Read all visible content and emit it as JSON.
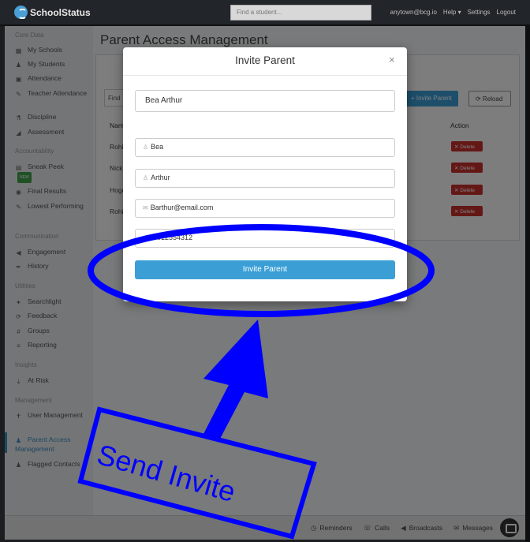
{
  "topbar": {
    "brand": "SchoolStatus",
    "search_placeholder": "Find a student...",
    "links": [
      "anytown@bcg.io",
      "Help ▾",
      "Settings",
      "Logout"
    ]
  },
  "sidebar": {
    "core_data": {
      "heading": "Core Data",
      "items": [
        {
          "label": "My Schools",
          "icon": "building-icon"
        },
        {
          "label": "My Students",
          "icon": "users-icon"
        },
        {
          "label": "Attendance",
          "icon": "calendar-icon"
        },
        {
          "label": "Teacher Attendance",
          "icon": "pencil-icon"
        },
        {
          "label": "Discipline",
          "icon": "flask-icon"
        },
        {
          "label": "Assessment",
          "icon": "chart-icon"
        }
      ]
    },
    "accountability": {
      "heading": "Accountability",
      "items": [
        {
          "label": "Sneak Peek",
          "icon": "document-icon",
          "badge": "NEW"
        },
        {
          "label": "Final Results",
          "icon": "eye-icon"
        },
        {
          "label": "Lowest Performing",
          "icon": "pencil-icon"
        }
      ]
    },
    "communication": {
      "heading": "Communication",
      "items": [
        {
          "label": "Engagement",
          "icon": "megaphone-icon"
        },
        {
          "label": "History",
          "icon": "pen-icon"
        }
      ]
    },
    "utilities": {
      "heading": "Utilities",
      "items": [
        {
          "label": "Searchlight",
          "icon": "flashlight-icon"
        },
        {
          "label": "Feedback",
          "icon": "refresh-icon"
        },
        {
          "label": "Groups",
          "icon": "grid-icon"
        },
        {
          "label": "Reporting",
          "icon": "list-icon"
        }
      ]
    },
    "insights": {
      "heading": "Insights",
      "items": [
        {
          "label": "At Risk",
          "icon": "download-icon"
        }
      ]
    },
    "management": {
      "heading": "Management",
      "items": [
        {
          "label": "User Management",
          "icon": "person-icon"
        },
        {
          "label": "Parent Access Management",
          "icon": "user-plus-icon",
          "active": true
        },
        {
          "label": "Flagged Contacts",
          "icon": "user-flag-icon"
        }
      ]
    }
  },
  "main": {
    "title": "Parent Access Management",
    "filter_label": "Find",
    "invite_button": "+ Invite Parent",
    "reload_button": "⟳ Reload",
    "columns": {
      "name": "Nam",
      "action": "Action"
    },
    "rows": [
      {
        "name": "Rohi",
        "action": "✕ Delete"
      },
      {
        "name": "Nick",
        "action": "✕ Delete"
      },
      {
        "name": "Hoge",
        "action": "✕ Delete"
      },
      {
        "name": "Rohi",
        "action": "✕ Delete"
      }
    ]
  },
  "bottombar": {
    "items": [
      {
        "label": "Reminders",
        "icon": "clock-icon"
      },
      {
        "label": "Calls",
        "icon": "phone-icon"
      },
      {
        "label": "Broadcasts",
        "icon": "megaphone-icon"
      },
      {
        "label": "Messages",
        "icon": "chat-icon"
      }
    ]
  },
  "modal": {
    "title": "Invite Parent",
    "close": "×",
    "student_value": "Bea Arthur",
    "first_name": "Bea",
    "last_name": "Arthur",
    "email": "Barthur@email.com",
    "phone": "6012554312",
    "submit": "Invite Parent"
  },
  "annotation": {
    "text": "Send Invite",
    "color": "#0000ff"
  }
}
